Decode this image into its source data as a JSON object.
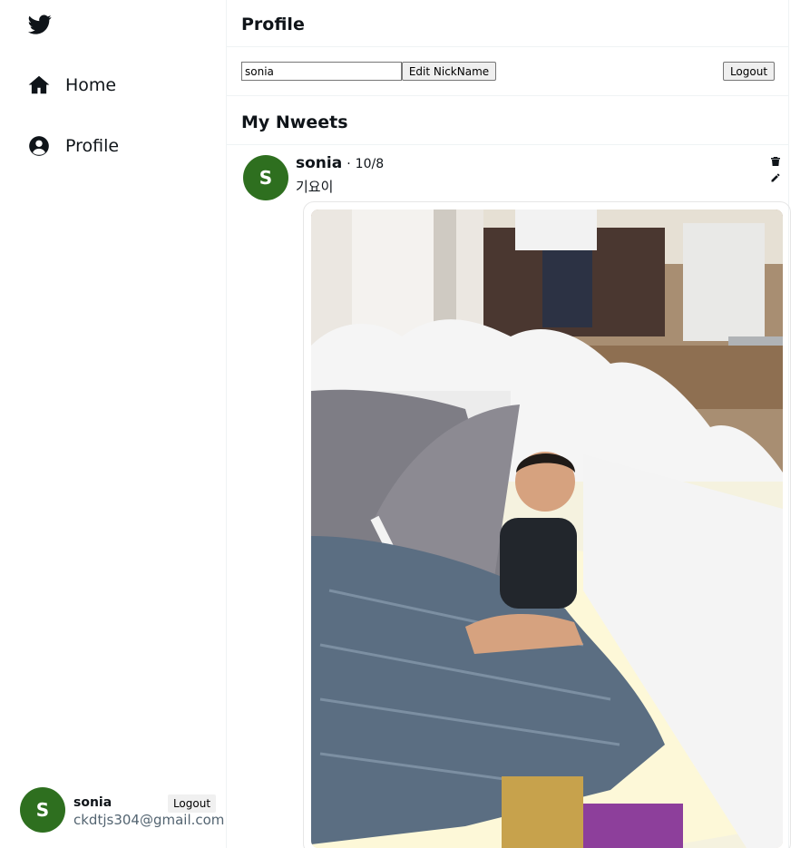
{
  "sidebar": {
    "logo_icon": "twitter-bird-icon",
    "nav": [
      {
        "label": "Home",
        "icon": "home-icon"
      },
      {
        "label": "Profile",
        "icon": "user-circle-icon"
      }
    ],
    "account": {
      "avatar_letter": "S",
      "name": "sonia",
      "email": "ckdtjs304@gmail.com",
      "logout_label": "Logout"
    }
  },
  "main": {
    "title": "Profile",
    "nickname_value": "sonia",
    "edit_label": "Edit NickName",
    "logout_label": "Logout",
    "section_title": "My Nweets"
  },
  "nweet": {
    "avatar_letter": "S",
    "name": "sonia",
    "separator": "·",
    "date": "10/8",
    "text": "기요이",
    "actions": [
      "trash-icon",
      "pencil-icon"
    ]
  },
  "colors": {
    "avatar_bg": "#2e6f1f",
    "border": "#eff3f4",
    "text": "#0f1419",
    "muted": "#536471"
  }
}
